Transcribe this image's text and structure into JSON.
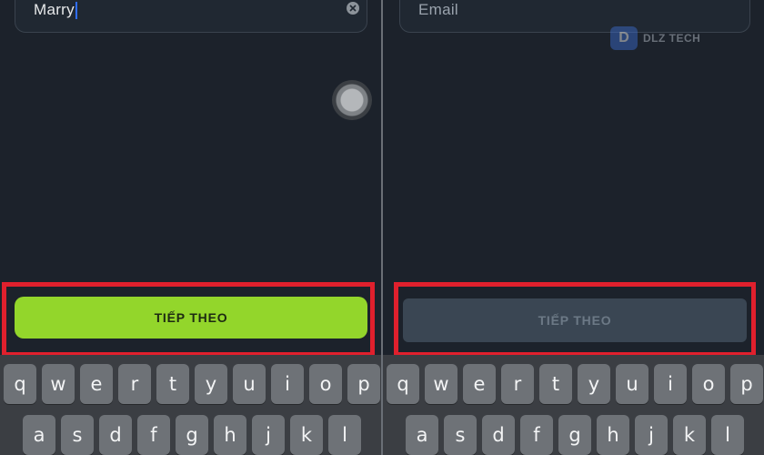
{
  "left_screen": {
    "name_field": {
      "value": "Marry"
    },
    "next_button": {
      "label": "TIẾP THEO",
      "state": "enabled",
      "color": "#93d62b"
    }
  },
  "right_screen": {
    "email_field": {
      "placeholder": "Email"
    },
    "next_button": {
      "label": "TIẾP THEO",
      "state": "disabled",
      "color": "#3a4653"
    },
    "watermark": {
      "text": "DLZ TECH",
      "logo_letter": "D"
    }
  },
  "keyboard": {
    "row1": [
      "q",
      "w",
      "e",
      "r",
      "t",
      "y",
      "u",
      "i",
      "o",
      "p"
    ],
    "row2": [
      "a",
      "s",
      "d",
      "f",
      "g",
      "h",
      "j",
      "k",
      "l"
    ]
  },
  "highlight_color": "#e0202d"
}
